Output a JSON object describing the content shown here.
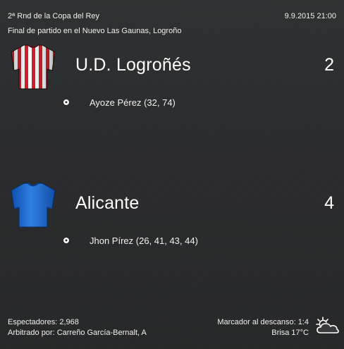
{
  "header": {
    "competition": "2ª Rnd de la Copa del Rey",
    "datetime": "9.9.2015 21:00",
    "venue": "Final de partido en el Nuevo Las Gaunas, Logroño"
  },
  "home": {
    "name": "U.D. Logroñés",
    "score": "2",
    "scorers": "Ayoze Pérez (32, 74)",
    "kit_icon": "red-white-striped-shirt-icon",
    "kit_colors": {
      "primary": "#d8202c",
      "secondary": "#ffffff"
    }
  },
  "away": {
    "name": "Alicante",
    "score": "4",
    "scorers": "Jhon Pírez (26, 41, 43, 44)",
    "kit_icon": "blue-shirt-icon",
    "kit_colors": {
      "primary": "#1c63c8",
      "secondary": "#3a87e6"
    }
  },
  "footer": {
    "attendance": "Espectadores: 2,968",
    "referee": "Arbitrado por: Carreño García-Bernalt, A",
    "halftime": "Marcador al descanso: 1:4",
    "weather": "Brisa 17°C",
    "weather_icon": "partly-cloudy-icon"
  },
  "colors": {
    "background": "#2a2b2c",
    "text": "#ffffff"
  }
}
